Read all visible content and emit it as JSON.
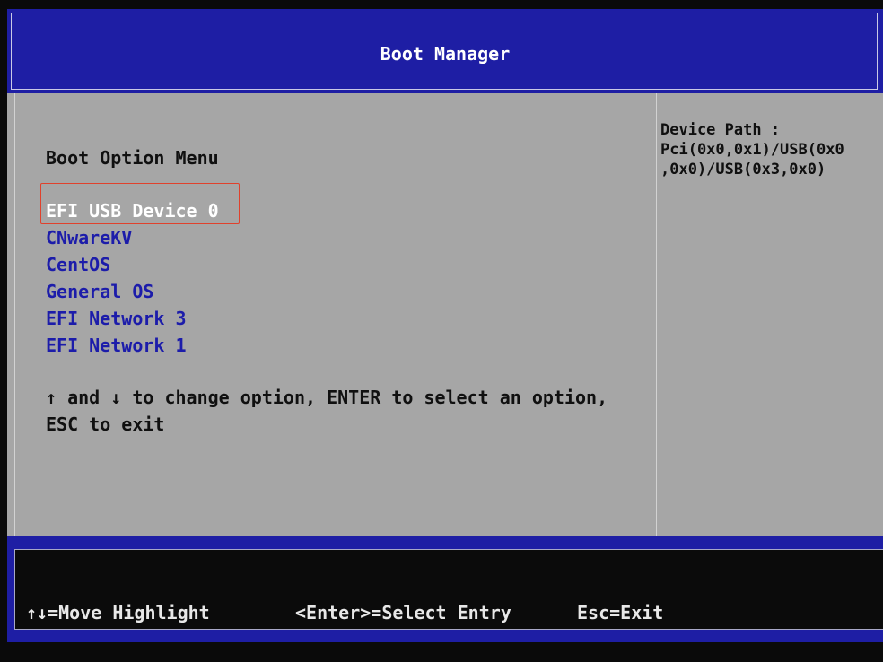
{
  "header": {
    "title": "Boot Manager"
  },
  "menu": {
    "title": "Boot Option Menu",
    "items": [
      {
        "label": "EFI USB Device 0",
        "selected": true
      },
      {
        "label": "CNwareKV"
      },
      {
        "label": "CentOS"
      },
      {
        "label": "General OS"
      },
      {
        "label": "EFI Network 3"
      },
      {
        "label": "EFI Network 1"
      }
    ],
    "help_line1": "↑ and ↓ to change option, ENTER to select an option,",
    "help_line2": "ESC to exit"
  },
  "device_path": {
    "label": "Device Path :",
    "line1": "Pci(0x0,0x1)/USB(0x0",
    "line2": ",0x0)/USB(0x3,0x0)"
  },
  "footer": {
    "move": "↑↓=Move Highlight",
    "enter": "<Enter>=Select Entry",
    "esc": "Esc=Exit"
  },
  "colors": {
    "header_bg": "#1e1ea4",
    "panel_bg": "#a6a6a6",
    "item_text": "#1c1caa",
    "selected_text": "#ffffff",
    "highlight_border": "#e0412c"
  }
}
